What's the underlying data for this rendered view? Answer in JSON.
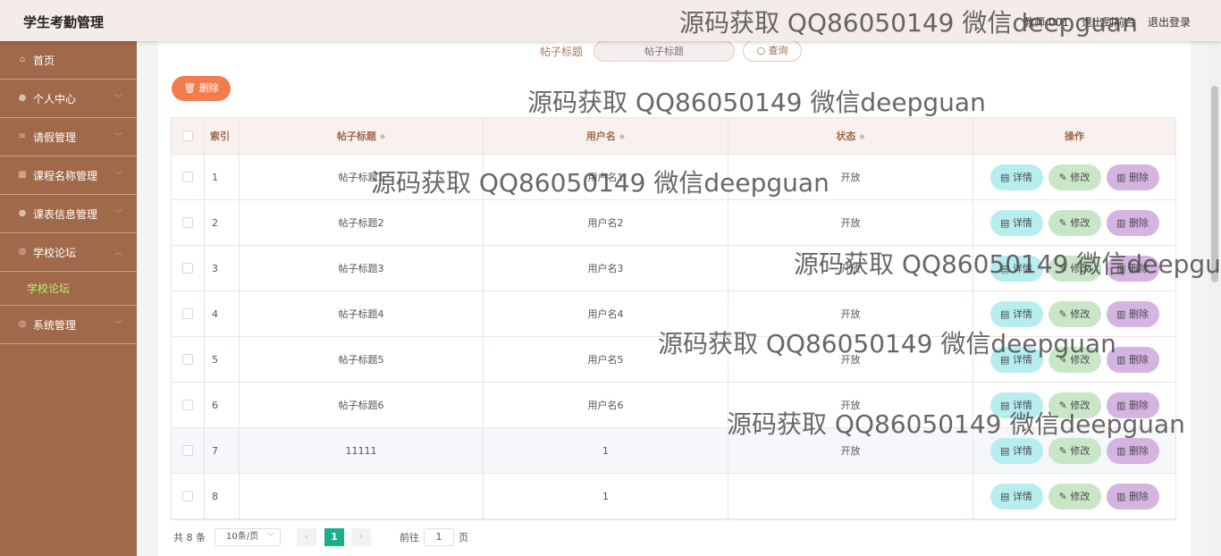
{
  "app": {
    "title": "学生考勤管理"
  },
  "header": {
    "user_text": "教师 001",
    "back_label": "退出到前台",
    "logout_label": "退出登录"
  },
  "sidebar": {
    "items": [
      {
        "label": "首页",
        "icon": "home-icon"
      },
      {
        "label": "个人中心",
        "icon": "user-icon"
      },
      {
        "label": "请假管理",
        "icon": "list-icon"
      },
      {
        "label": "课程名称管理",
        "icon": "grid-icon"
      },
      {
        "label": "课表信息管理",
        "icon": "user-icon"
      },
      {
        "label": "学校论坛",
        "icon": "pin-icon"
      }
    ],
    "sub_active": "学校论坛",
    "last_item": {
      "label": "系统管理",
      "icon": "pin-icon"
    }
  },
  "search": {
    "label": "帖子标题",
    "placeholder": "帖子标题",
    "button_label": "查询"
  },
  "toolbar": {
    "delete_label": "删除"
  },
  "table": {
    "columns": [
      "索引",
      "帖子标题",
      "用户名",
      "状态",
      "操作"
    ],
    "rows": [
      {
        "index": "1",
        "title": "帖子标题1",
        "user": "用户名1",
        "status": "开放"
      },
      {
        "index": "2",
        "title": "帖子标题2",
        "user": "用户名2",
        "status": "开放"
      },
      {
        "index": "3",
        "title": "帖子标题3",
        "user": "用户名3",
        "status": "开放"
      },
      {
        "index": "4",
        "title": "帖子标题4",
        "user": "用户名4",
        "status": "开放"
      },
      {
        "index": "5",
        "title": "帖子标题5",
        "user": "用户名5",
        "status": "开放"
      },
      {
        "index": "6",
        "title": "帖子标题6",
        "user": "用户名6",
        "status": "开放"
      },
      {
        "index": "7",
        "title": "11111",
        "user": "1",
        "status": "开放"
      },
      {
        "index": "8",
        "title": "",
        "user": "1",
        "status": ""
      }
    ],
    "actions": {
      "detail": "详情",
      "edit": "修改",
      "delete": "删除"
    }
  },
  "pagination": {
    "total_text": "共 8 条",
    "page_size": "10条/页",
    "current_page": "1",
    "goto_label": "前往",
    "goto_value": "1",
    "page_suffix": "页"
  },
  "watermark": "源码获取 QQ86050149 微信deepguan"
}
